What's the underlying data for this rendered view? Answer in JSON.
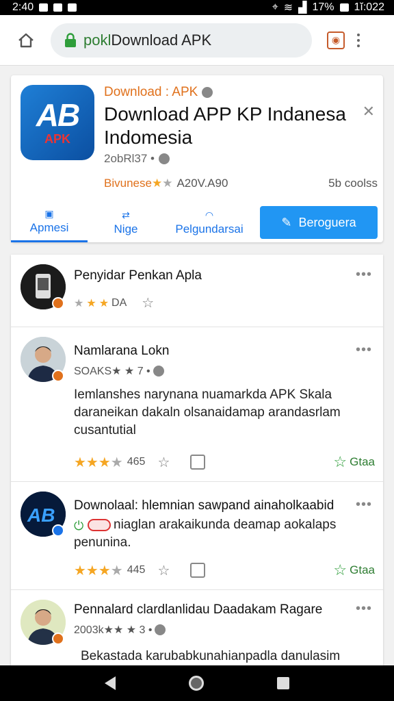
{
  "status_bar": {
    "time": "2:40",
    "battery": "17%",
    "clock": "1ĭ:022"
  },
  "browser": {
    "url_prefix": "pokl",
    "url_rest": "Download APK"
  },
  "app_card": {
    "publisher": "Download : APK",
    "title": "Download APP KP Indanesa Indomesia",
    "meta": "2obRl37 •",
    "rating_label": "Bivunese",
    "rating_count": "A20V.A90",
    "rating_right": "5b coolss",
    "tabs": [
      {
        "label": "Apmesi"
      },
      {
        "label": "Nige"
      },
      {
        "label": "Pelgundarsai"
      }
    ],
    "primary_button": "Beroguera"
  },
  "feed": {
    "posts": [
      {
        "title": "Penyidar Penkan Apla",
        "meta": "DA",
        "body": ""
      },
      {
        "title": "Namlarana Lokn",
        "meta": "SOAKS★ ★ 7 •",
        "body": "Iemlanshes narynana nuamarkda APK Skala daraneikan dakaln olsanaidamap arandasrlam cusantutial",
        "likes": "465",
        "share": "Gtaa"
      },
      {
        "title": "Downolaal: hlemnian sawpand ainaholkaabid",
        "meta": "",
        "body": "niaglan arakaikunda deamap aokalaps penunina.",
        "likes": "445",
        "share": "Gtaa"
      },
      {
        "title": "Pennalard clardlanlidau Daadakam Ragare",
        "meta": "2003k★★ ★ 3 •",
        "body": "Bekastada karubabkunahianpadla danulasim"
      }
    ]
  },
  "colors": {
    "accent": "#1a73e8",
    "brand_orange": "#e0711c",
    "star": "#f5a623",
    "share_green": "#2e7d32"
  }
}
